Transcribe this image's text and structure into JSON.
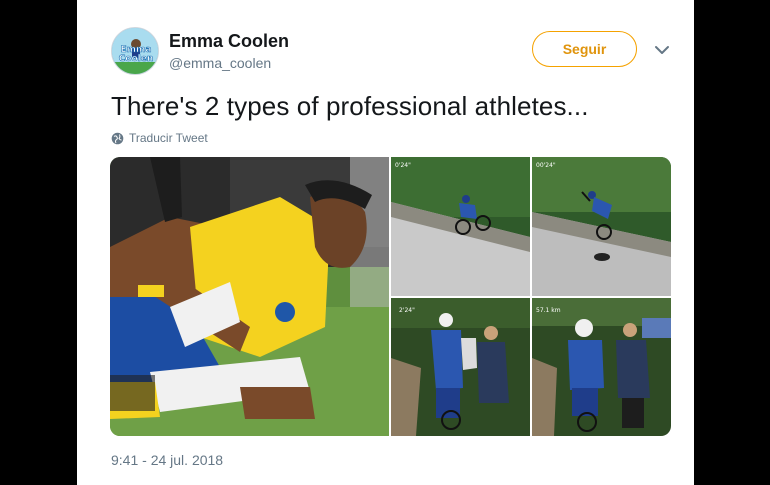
{
  "tweet": {
    "display_name": "Emma Coolen",
    "handle": "@emma_coolen",
    "avatar_text": [
      "Emma",
      "Coolen"
    ],
    "follow_label": "Seguir",
    "menu_icon": "chevron-down-icon",
    "text": "There's 2 types of professional athletes...",
    "translate_label": "Traducir Tweet",
    "translate_icon": "globe-icon",
    "timestamp": "9:41 - 24 jul. 2018"
  },
  "media": {
    "photos": [
      {
        "id": "soccer",
        "description": "Football player in yellow jersey on grass"
      },
      {
        "id": "cyclist-crash-1",
        "overlay": "0'24\""
      },
      {
        "id": "cyclist-crash-2",
        "overlay": "00'24\""
      },
      {
        "id": "cyclist-recovery-1",
        "overlay": "2'24\""
      },
      {
        "id": "cyclist-recovery-2",
        "overlay": "57.1 km"
      }
    ]
  },
  "colors": {
    "accent": "#f5a200",
    "text_primary": "#14171a",
    "text_secondary": "#657786",
    "background": "#ffffff",
    "frame": "#000000"
  }
}
